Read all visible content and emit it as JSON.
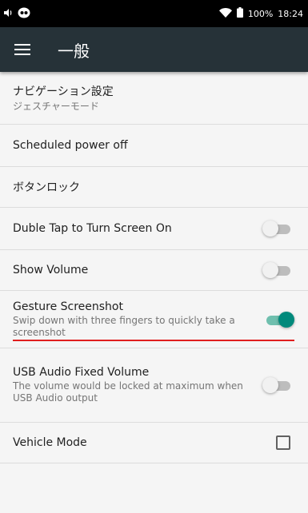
{
  "status_bar": {
    "battery_percent": "100%",
    "time": "18:24",
    "icons": [
      "volume-icon",
      "notification-app-icon",
      "wifi-icon",
      "battery-icon"
    ]
  },
  "toolbar": {
    "title": "一般",
    "menu_icon": "hamburger-menu-icon"
  },
  "settings": {
    "navigation": {
      "title": "ナビゲーション設定",
      "summary": "ジェスチャーモード"
    },
    "scheduled_power_off": {
      "title": "Scheduled power off"
    },
    "button_lock": {
      "title": "ボタンロック"
    },
    "double_tap": {
      "title": "Duble Tap to Turn Screen On",
      "enabled": false
    },
    "show_volume": {
      "title": "Show Volume",
      "enabled": false
    },
    "gesture_screenshot": {
      "title": "Gesture Screenshot",
      "summary": "Swip down with three fingers to quickly take a screenshot",
      "enabled": true
    },
    "usb_audio": {
      "title": "USB Audio Fixed Volume",
      "summary": "The volume would be locked at maximum when USB Audio output",
      "enabled": false
    },
    "vehicle_mode": {
      "title": "Vehicle Mode",
      "checked": false
    }
  },
  "colors": {
    "toolbar_bg": "#263238",
    "switch_on": "#00897b",
    "highlight_underline": "#e01e1e"
  }
}
